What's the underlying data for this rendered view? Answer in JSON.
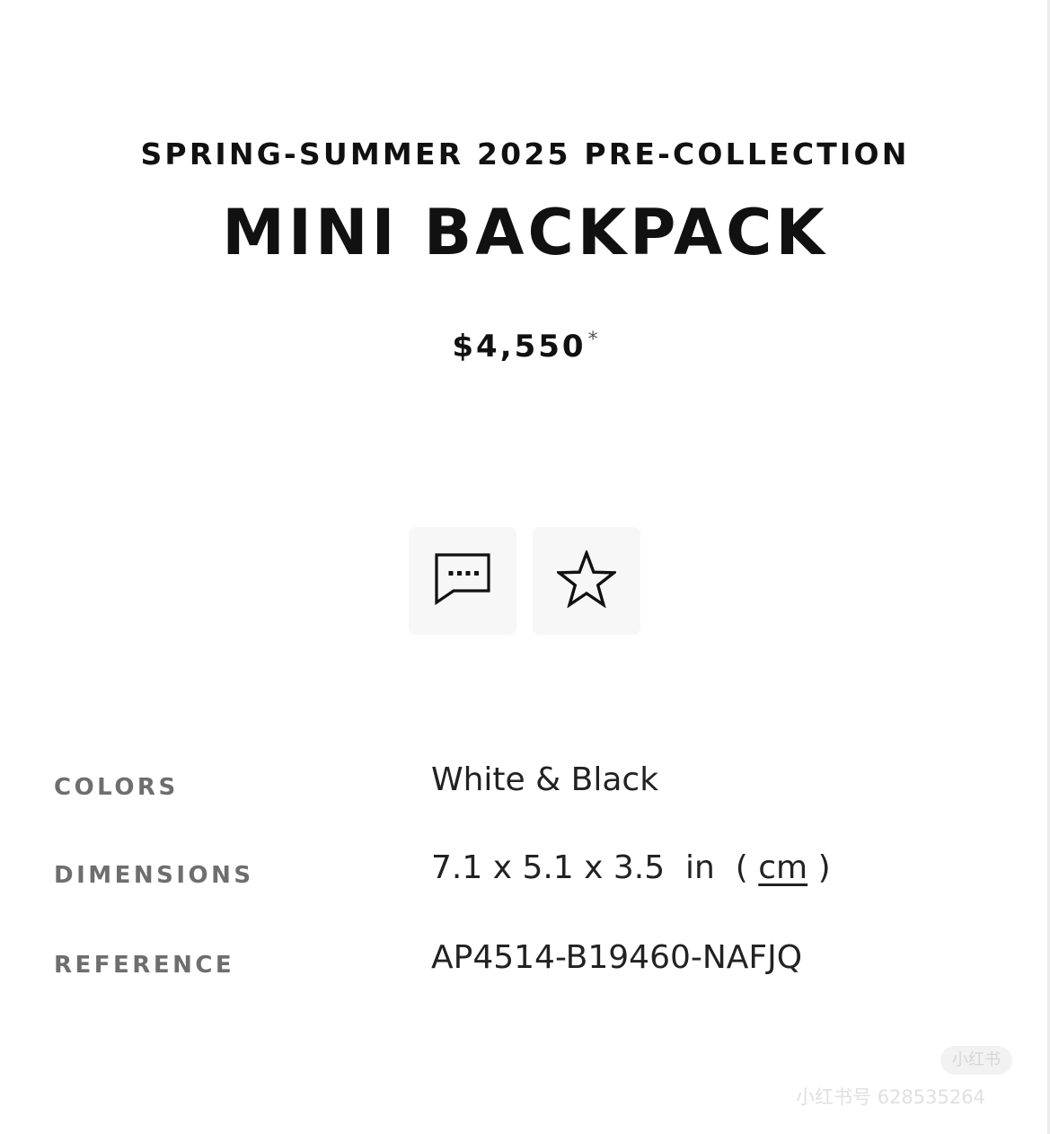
{
  "product": {
    "collection": "SPRING-SUMMER 2025 PRE-COLLECTION",
    "name": "MINI BACKPACK",
    "price": "$4,550",
    "price_note_marker": "*"
  },
  "actions": {
    "contact_icon": "message-dots-icon",
    "wishlist_icon": "star-outline-icon"
  },
  "details": {
    "colors_label": "COLORS",
    "colors_value": "White & Black",
    "dimensions_label": "DIMENSIONS",
    "dimensions_value": "7.1 x 5.1 x 3.5",
    "dimensions_unit": "in",
    "dimensions_alt_unit": "cm",
    "reference_label": "REFERENCE",
    "reference_value": "AP4514-B19460-NAFJQ"
  },
  "watermark": {
    "badge": "小红书",
    "text": "小红书号 628535264"
  },
  "colors": {
    "text_primary": "#111111",
    "label_gray": "#6e6e6e",
    "button_bg": "#f7f7f7",
    "background": "#ffffff"
  }
}
